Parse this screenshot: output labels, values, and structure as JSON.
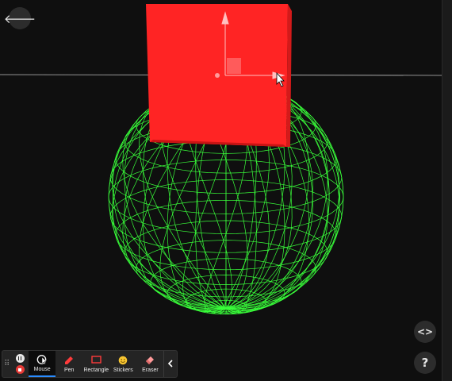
{
  "toolbar": {
    "tools": [
      {
        "label": "Mouse",
        "icon": "mouse-icon",
        "active": true
      },
      {
        "label": "Pen",
        "icon": "pen-icon",
        "active": false
      },
      {
        "label": "Rectangle",
        "icon": "rectangle-icon",
        "active": false
      },
      {
        "label": "Stickers",
        "icon": "sticker-icon",
        "active": false
      },
      {
        "label": "Eraser",
        "icon": "eraser-icon",
        "active": false
      }
    ],
    "record": {
      "pause_icon": "pause-icon",
      "stop_icon": "stop-icon"
    },
    "collapse_icon": "chevron-left-icon"
  },
  "buttons": {
    "back_icon": "back-arrow-icon",
    "back_glyph": "🡐",
    "code_icon": "code-icon",
    "code_glyph": "<>",
    "help_icon": "help-icon",
    "help_glyph": "?"
  },
  "scene": {
    "background": "#0f0f0f",
    "sphere_color": "#39ff3a",
    "cube_color": "#ff2222",
    "accent": "#2a8cff"
  }
}
